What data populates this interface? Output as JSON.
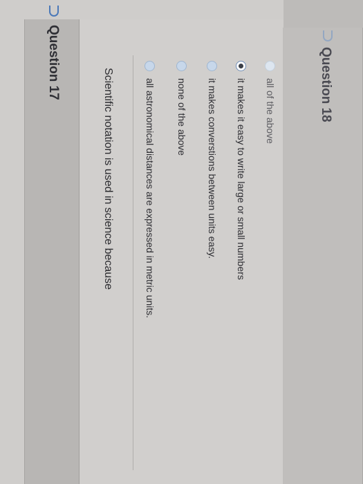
{
  "question17": {
    "title": "Question 17",
    "prompt": "Scientific notation is used in science because",
    "options": [
      {
        "label": "all astronomical distances are expressed in metric units.",
        "selected": false
      },
      {
        "label": "none of the above",
        "selected": false
      },
      {
        "label": "it makes converstions between units easy.",
        "selected": false
      },
      {
        "label": "it makes it easy to write large or small numbers",
        "selected": true
      },
      {
        "label": "all of the above",
        "selected": false
      }
    ]
  },
  "question18": {
    "title": "Question 18"
  },
  "colors": {
    "radio_fill": "#c7d7ea",
    "flag_blue": "#4a78b8",
    "header_bg": "#b8b6b4"
  }
}
